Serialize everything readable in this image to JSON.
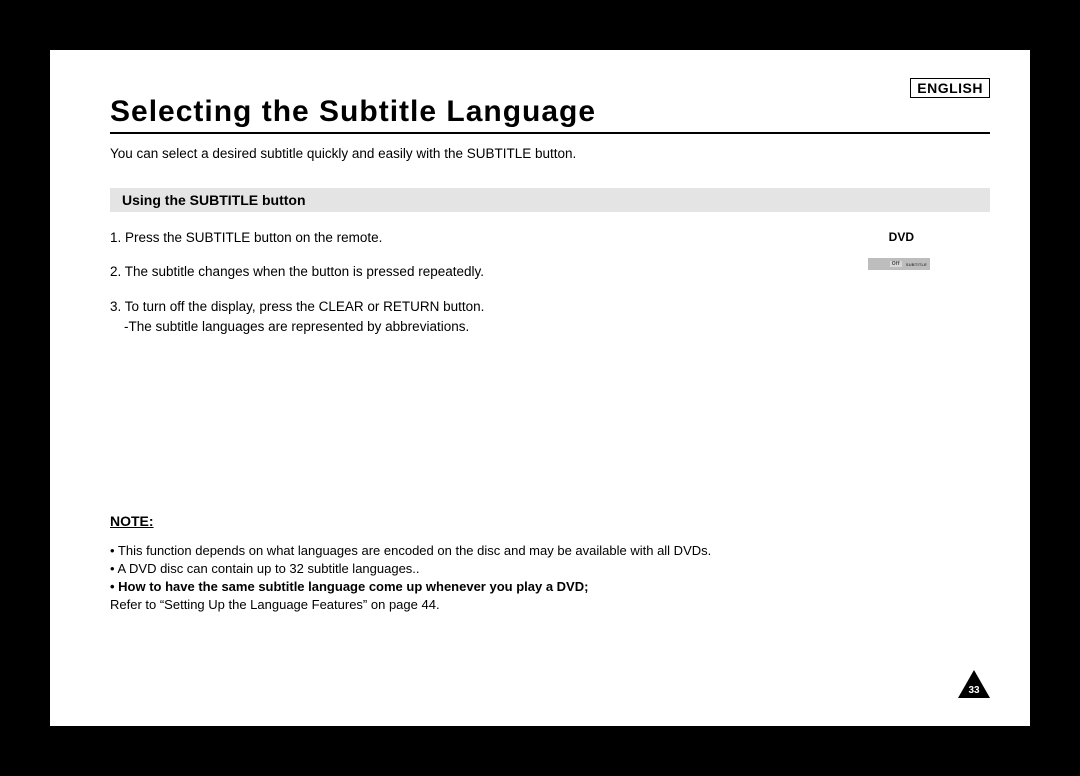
{
  "langTag": "ENGLISH",
  "title": "Selecting the Subtitle Language",
  "intro": "You can select a desired subtitle quickly and easily with the SUBTITLE button.",
  "sectionHeading": "Using the SUBTITLE button",
  "steps": {
    "s1": "1. Press the SUBTITLE button on the remote.",
    "s2": "2. The subtitle changes when the button is pressed repeatedly.",
    "s3a": "3. To turn off the display, press the CLEAR or RETURN button.",
    "s3b": "-The subtitle languages are represented by abbreviations."
  },
  "dvdLabel": "DVD",
  "osd": {
    "off": "Off",
    "subtitle": "SUBTITLE"
  },
  "note": {
    "heading": "NOTE:",
    "l1": "• This function depends on what languages are encoded on the disc and may be available with all DVDs.",
    "l2": "• A DVD disc can contain up to 32 subtitle languages..",
    "l3": "• How to have the same subtitle language come up whenever you play a DVD;",
    "l4": "  Refer to “Setting Up the Language Features” on page 44."
  },
  "pageNumber": "33"
}
